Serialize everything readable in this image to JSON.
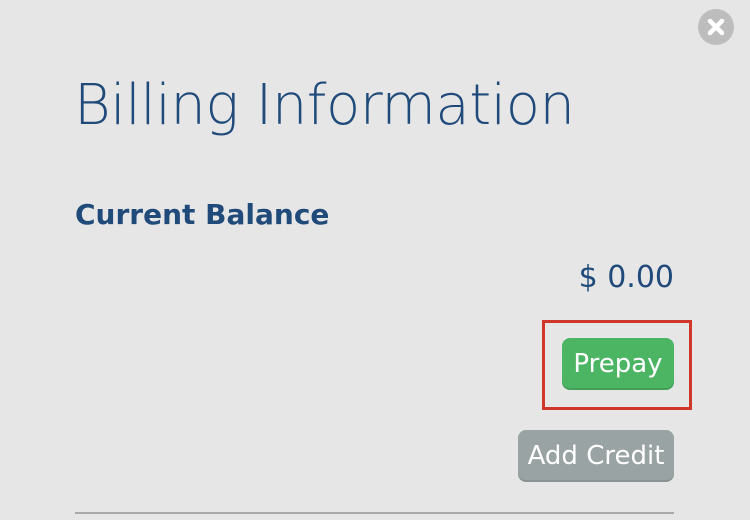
{
  "dialog": {
    "close_icon": "close-icon",
    "title": "Billing Information",
    "section_title": "Current Balance",
    "balance": "$ 0.00",
    "buttons": {
      "prepay_label": "Prepay",
      "add_credit_label": "Add Credit"
    },
    "colors": {
      "title": "#1f4a7a",
      "prepay_bg": "#4cb563",
      "add_credit_bg": "#9aa3a4",
      "highlight": "#d0372a",
      "background": "#e6e6e6"
    }
  }
}
